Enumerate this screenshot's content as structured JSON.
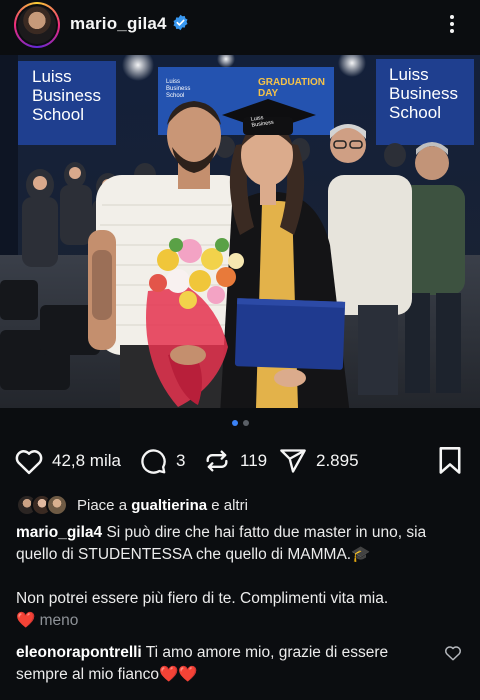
{
  "post": {
    "username": "mario_gila4",
    "verified": true
  },
  "photo": {
    "signs": {
      "left_brand": [
        "Luiss",
        "Business",
        "School"
      ],
      "right_brand": [
        "Luiss",
        "Business",
        "School"
      ],
      "center_small": [
        "Luiss",
        "Business",
        "School"
      ],
      "center_event": [
        "GRADUATION",
        "DAY"
      ]
    },
    "cap_text": [
      "Luiss",
      "Business"
    ],
    "carousel": {
      "count": 2,
      "active": 1
    }
  },
  "actions": {
    "likes_count": "42,8 mila",
    "comments_count": "3",
    "reposts_count": "119",
    "shares_count": "2.895"
  },
  "liked_by": {
    "prefix": "Piace a",
    "user": "gualtierina",
    "suffix": "e altri"
  },
  "caption": {
    "username": "mario_gila4",
    "text1": "Si può dire che hai fatto due master in uno, sia quello di STUDENTESSA che quello di MAMMA.🎓",
    "text2": "Non potrei essere più fiero di te. Complimenti vita mia.",
    "emoji": "❤️",
    "less_label": "meno"
  },
  "comment": {
    "username": "eleonorapontrelli",
    "text": "Ti amo amore mio, grazie di essere sempre al mio fianco",
    "emoji": "❤️❤️"
  },
  "icons": {
    "like": "heart-icon",
    "comment": "speech-bubble-icon",
    "repost": "repost-icon",
    "share": "send-icon",
    "save": "bookmark-icon",
    "menu": "more-vertical-icon"
  },
  "colors": {
    "background": "#0b0d10",
    "accent_blue": "#3b82f6",
    "verified": "#3897f0",
    "heart": "#ff3b5c"
  }
}
